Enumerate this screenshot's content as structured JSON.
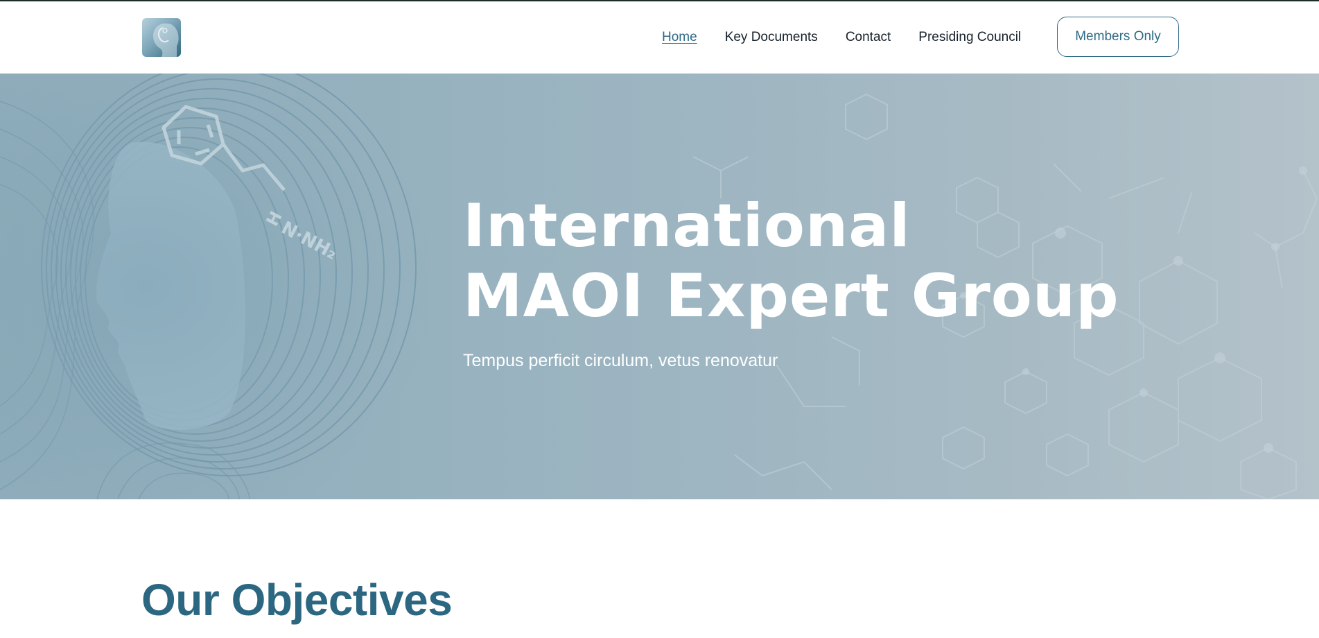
{
  "nav": {
    "items": [
      {
        "label": "Home",
        "active": true
      },
      {
        "label": "Key Documents",
        "active": false
      },
      {
        "label": "Contact",
        "active": false
      },
      {
        "label": "Presiding Council",
        "active": false
      }
    ],
    "cta_label": "Members Only"
  },
  "hero": {
    "title_line1": "International",
    "title_line2": "MAOI Expert Group",
    "subtitle": "Tempus perficit circulum, vetus renovatur",
    "molecule_label": "N·NH₂",
    "molecule_h": "H"
  },
  "objectives": {
    "heading": "Our Objectives"
  },
  "colors": {
    "accent": "#2f6a86",
    "heading": "#2c6782",
    "hero_bg": "#99b3c0"
  },
  "icons": {
    "logo": "head-profile-logo-icon"
  }
}
